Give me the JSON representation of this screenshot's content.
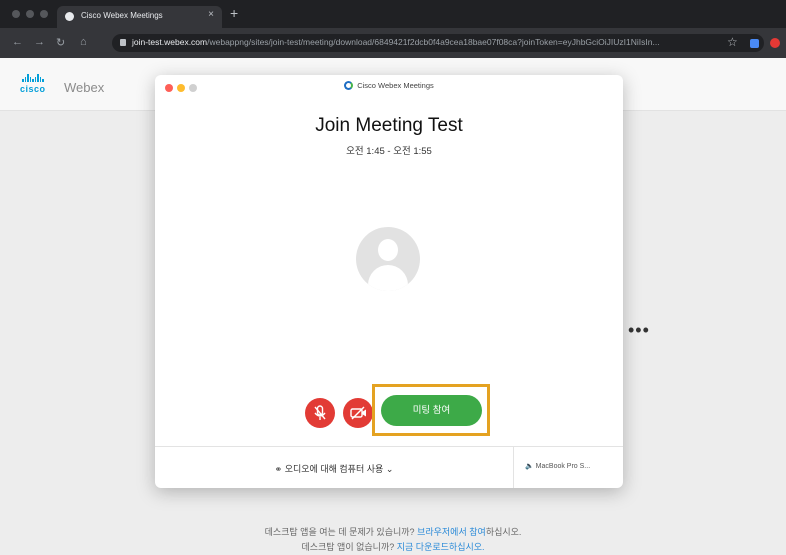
{
  "browser": {
    "tab_title": "Cisco Webex Meetings",
    "tab_close": "×",
    "new_tab": "+",
    "url_host": "join-test.webex.com",
    "url_path": "/webappng/sites/join-test/meeting/download/6849421f2dcb0f4a9cea18bae07f08ca?joinToken=eyJhbGciOiJIUzI1NiIsIn...",
    "star": "☆"
  },
  "page": {
    "logo_cisco": "cisco",
    "logo_product": "Webex",
    "more": "•••",
    "help_line1_prefix": "데스크탑 앱을 여는 데 문제가 있습니까? ",
    "help_line1_link": "브라우저에서 참여",
    "help_line1_suffix": "하십시오.",
    "help_line2_prefix": "데스크탑 앱이 없습니까? ",
    "help_line2_link": "지금 다운로드하십시오."
  },
  "dialog": {
    "window_title": "Cisco Webex Meetings",
    "meeting_title": "Join Meeting Test",
    "meeting_time": "오전 1:45 - 오전 1:55",
    "join_button": "미팅 참여",
    "audio_option": "오디오에 대해 컴퓨터 사용",
    "speaker": "MacBook Pro S..."
  },
  "colors": {
    "join_green": "#3daa48",
    "mute_red": "#e23b35",
    "highlight": "#e4a221",
    "webex_blue": "#049fd9"
  }
}
